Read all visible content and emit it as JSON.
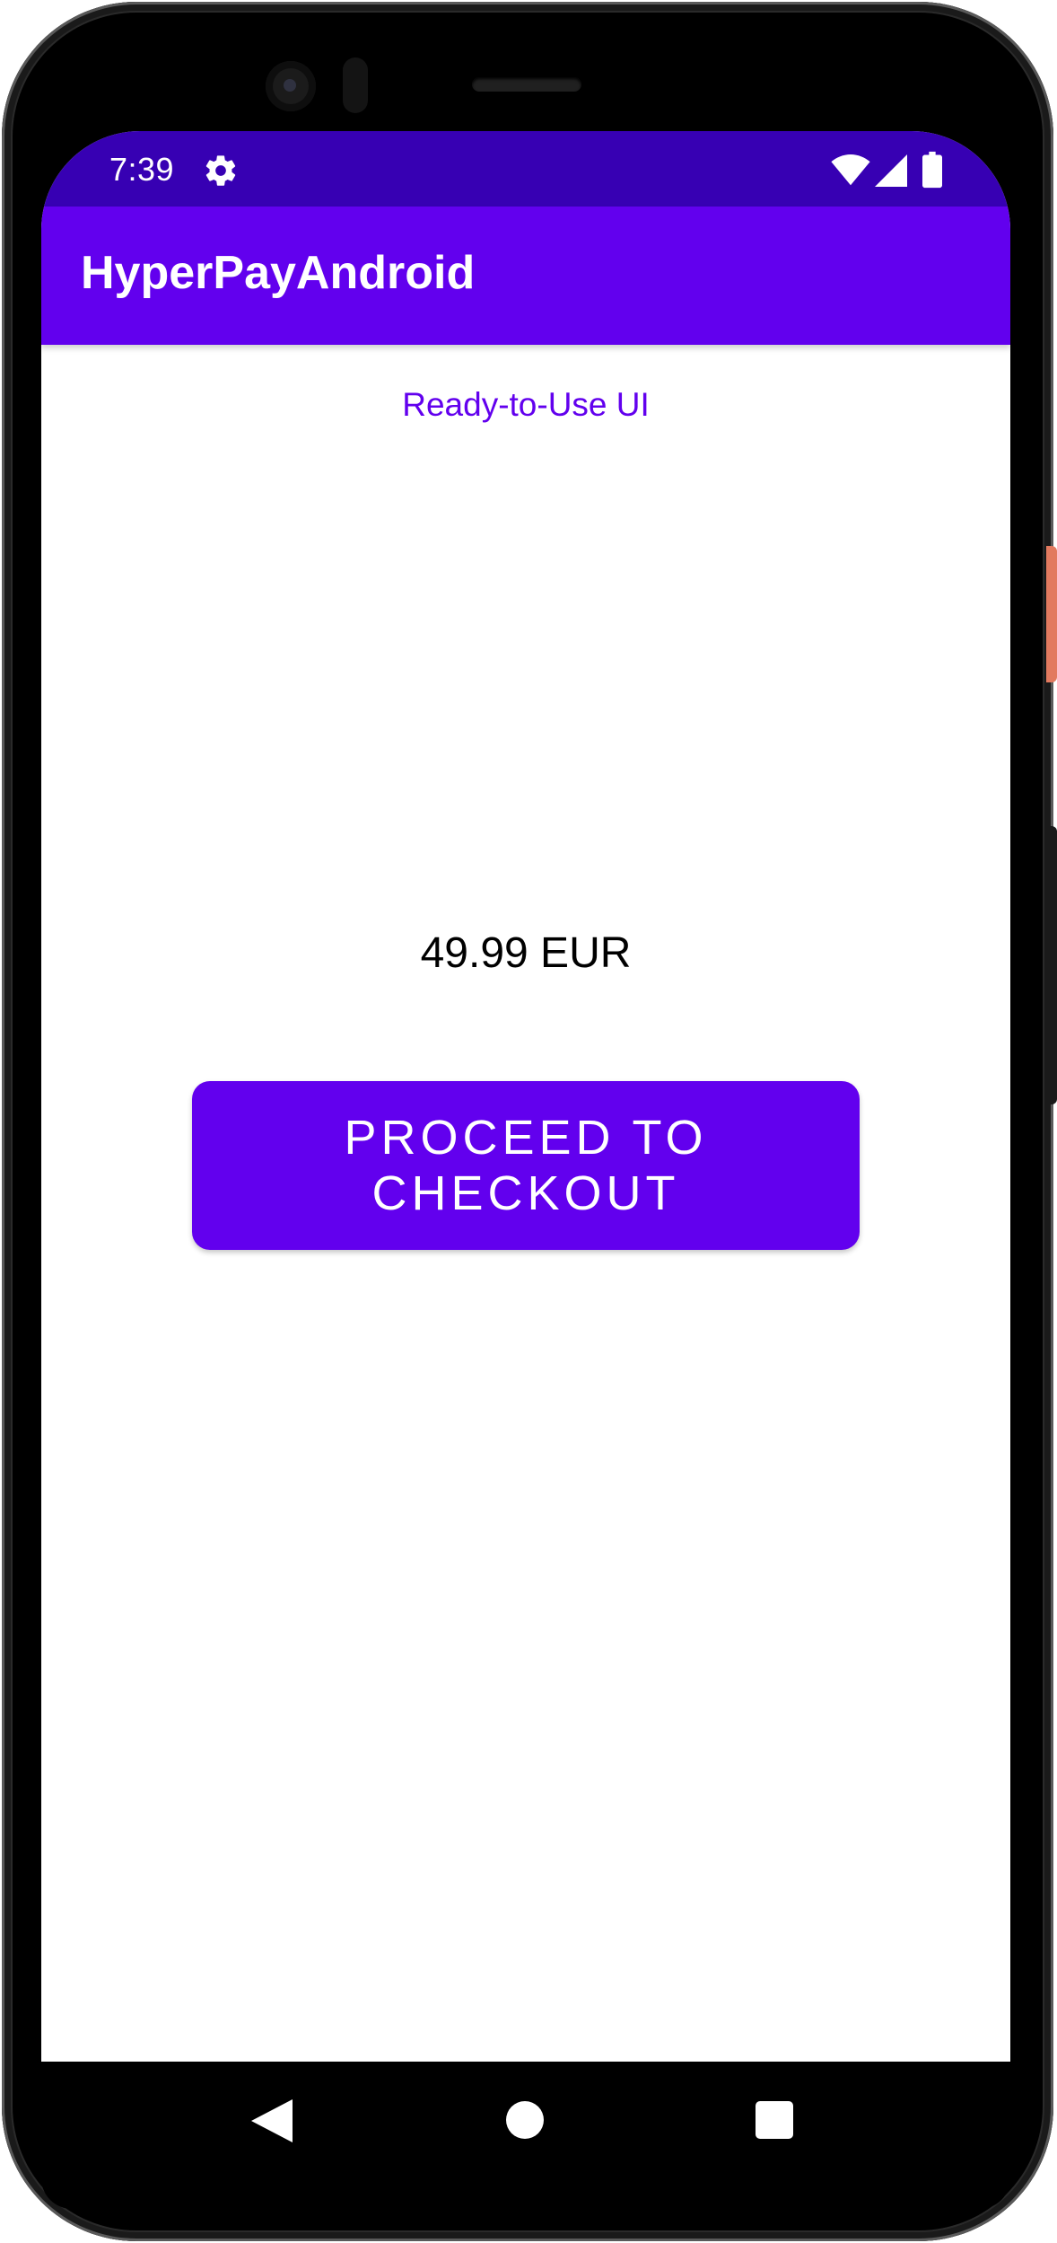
{
  "status_bar": {
    "time": "7:39",
    "icons": [
      "gear-icon",
      "wifi-icon",
      "signal-icon",
      "battery-icon"
    ],
    "background_color": "#3700b3"
  },
  "app_bar": {
    "title": "HyperPayAndroid",
    "background_color": "#6200ee"
  },
  "main": {
    "ready_link": "Ready-to-Use UI",
    "price": "49.99 EUR",
    "checkout_button": "PROCEED TO CHECKOUT",
    "accent_color": "#6200ee"
  },
  "nav_bar": {
    "icons": [
      "back-icon",
      "home-icon",
      "recents-icon"
    ]
  }
}
